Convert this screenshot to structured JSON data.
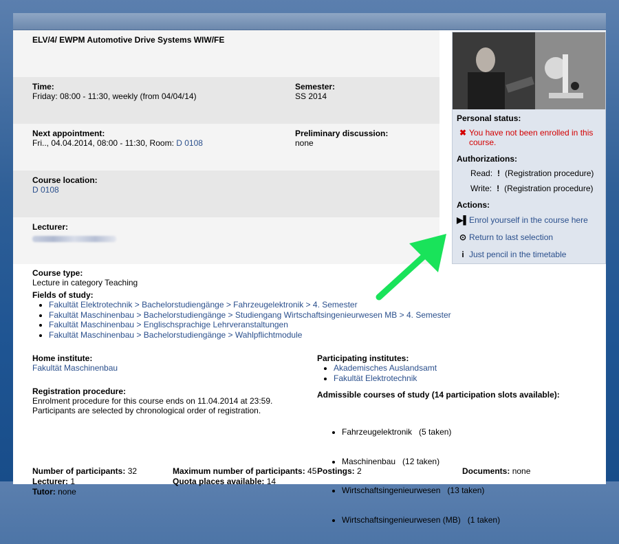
{
  "course": {
    "title": "ELV/4/ EWPM Automotive Drive Systems WIW/FE",
    "time_label": "Time:",
    "time_value": "Friday: 08:00 - 11:30, weekly (from 04/04/14)",
    "semester_label": "Semester:",
    "semester_value": "SS 2014",
    "next_label": "Next appointment:",
    "next_value_prefix": "Fri.., 04.04.2014, 08:00 - 11:30, Room: ",
    "next_room": "D 0108",
    "prelim_label": "Preliminary discussion:",
    "prelim_value": "none",
    "location_label": "Course location:",
    "location_value": "D 0108",
    "lecturer_label": "Lecturer:",
    "type_label": "Course type:",
    "type_value": "Lecture in category Teaching",
    "fields_label": "Fields of study:",
    "fields": [
      "Fakultät Elektrotechnik > Bachelorstudiengänge > Fahrzeugelektronik > 4. Semester",
      "Fakultät Maschinenbau > Bachelorstudiengänge > Studiengang Wirtschaftsingenieurwesen MB > 4. Semester",
      "Fakultät Maschinenbau > Englischsprachige Lehrveranstaltungen",
      "Fakultät Maschinenbau > Bachelorstudiengänge > Wahlpflichtmodule"
    ],
    "home_label": "Home institute:",
    "home_value": "Fakultät Maschinenbau",
    "participating_label": "Participating institutes:",
    "participating": [
      "Akademisches Auslandsamt",
      "Fakultät Elektrotechnik"
    ],
    "registration_label": "Registration procedure:",
    "registration_line1": "Enrolment procedure for this course ends on 11.04.2014 at 23:59.",
    "registration_line2": "Participants are selected by chronological order of registration.",
    "admissible_label": "Admissible courses of study (14 participation slots available):",
    "admissible": [
      "Fahrzeugelektronik   (5 taken)",
      "Maschinenbau   (12 taken)",
      "Wirtschaftsingenieurwesen   (13 taken)",
      "Wirtschaftsingenieurwesen (MB)   (1 taken)"
    ],
    "participants_label": "Number of participants:",
    "participants_value": "32",
    "max_label": "Maximum number of participants:",
    "max_value": "45",
    "postings_label": "Postings:",
    "postings_value": "2",
    "documents_label": "Documents:",
    "documents_value": "none",
    "lecturer_count_label": "Lecturer:",
    "lecturer_count_value": "1",
    "quota_label": "Quota places available:",
    "quota_value": "14",
    "tutor_label": "Tutor:",
    "tutor_value": "none"
  },
  "sidebar": {
    "personal_status_label": "Personal status:",
    "not_enrolled": "You have not been enrolled in this course.",
    "authorizations_label": "Authorizations:",
    "read_label": "Read:",
    "read_value": "(Registration procedure)",
    "write_label": "Write:",
    "write_value": "(Registration procedure)",
    "actions_label": "Actions:",
    "enrol": "Enrol yourself in the course here",
    "return": "Return to last selection",
    "pencil": "Just pencil in the timetable"
  },
  "colors": {
    "link": "#2a4f8c",
    "error": "#d30000",
    "arrow": "#19e35a"
  }
}
